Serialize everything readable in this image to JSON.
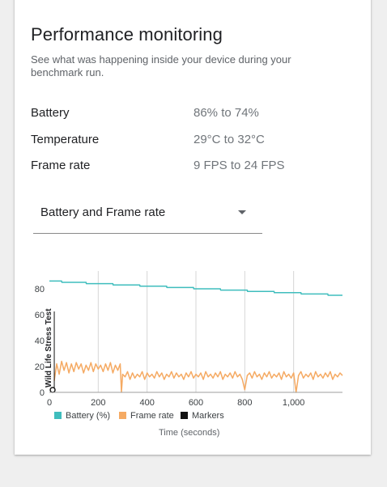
{
  "card": {
    "title": "Performance monitoring",
    "subtitle": "See what was happening inside your device during your benchmark run."
  },
  "metrics": [
    {
      "label": "Battery",
      "value": "86% to 74%"
    },
    {
      "label": "Temperature",
      "value": "29°C to 32°C"
    },
    {
      "label": "Frame rate",
      "value": "9 FPS to 24 FPS"
    }
  ],
  "dropdown": {
    "selected": "Battery and Frame rate",
    "icon": "arrow-drop-down-icon"
  },
  "colors": {
    "battery": "#3fbdbd",
    "frame_rate": "#f5aa63",
    "markers": "#111111",
    "grid": "#d6d6d6"
  },
  "chart_data": {
    "type": "line",
    "xlabel": "Time (seconds)",
    "ylabel": "",
    "xlim": [
      0,
      1200
    ],
    "ylim": [
      0,
      90
    ],
    "x_ticks": [
      0,
      200,
      400,
      600,
      800,
      1000
    ],
    "x_tick_labels": [
      "0",
      "200",
      "400",
      "600",
      "800",
      "1,000"
    ],
    "y_ticks": [
      0,
      20,
      40,
      60,
      80
    ],
    "y_tick_labels": [
      "0",
      "20",
      "40",
      "60",
      "80"
    ],
    "grid": "vertical",
    "legend_position": "bottom",
    "markers": [
      {
        "x": 20,
        "label": "Wild Life Stress Test"
      }
    ],
    "series": [
      {
        "name": "Battery (%)",
        "x": [
          0,
          50,
          51,
          150,
          151,
          260,
          261,
          370,
          371,
          480,
          481,
          590,
          591,
          700,
          701,
          810,
          811,
          920,
          921,
          1030,
          1031,
          1140,
          1141,
          1200
        ],
        "values": [
          86,
          86,
          85,
          85,
          84,
          84,
          83,
          83,
          82,
          82,
          81,
          81,
          80,
          80,
          79,
          79,
          78,
          78,
          77,
          77,
          76,
          76,
          75,
          75
        ]
      },
      {
        "name": "Frame rate",
        "x": [
          20,
          30,
          40,
          50,
          60,
          70,
          80,
          90,
          100,
          110,
          120,
          130,
          140,
          150,
          160,
          170,
          180,
          190,
          200,
          210,
          220,
          230,
          240,
          250,
          260,
          270,
          280,
          290,
          295,
          300,
          310,
          320,
          330,
          340,
          350,
          360,
          370,
          380,
          390,
          400,
          410,
          420,
          430,
          440,
          450,
          460,
          470,
          480,
          490,
          500,
          510,
          520,
          530,
          540,
          550,
          560,
          570,
          580,
          590,
          600,
          610,
          620,
          630,
          640,
          650,
          660,
          670,
          680,
          690,
          700,
          710,
          720,
          730,
          740,
          750,
          760,
          770,
          780,
          790,
          800,
          810,
          820,
          830,
          840,
          850,
          860,
          870,
          880,
          890,
          900,
          910,
          920,
          930,
          940,
          950,
          960,
          970,
          980,
          990,
          1000,
          1010,
          1020,
          1030,
          1040,
          1050,
          1060,
          1070,
          1080,
          1090,
          1100,
          1110,
          1120,
          1130,
          1140,
          1150,
          1160,
          1170,
          1180,
          1190,
          1200
        ],
        "values": [
          9,
          22,
          14,
          24,
          17,
          23,
          15,
          22,
          16,
          23,
          18,
          22,
          15,
          21,
          17,
          23,
          16,
          22,
          18,
          21,
          16,
          22,
          17,
          23,
          15,
          21,
          17,
          22,
          0,
          14,
          12,
          16,
          10,
          15,
          11,
          14,
          12,
          16,
          10,
          15,
          12,
          14,
          11,
          16,
          12,
          15,
          10,
          14,
          12,
          16,
          11,
          15,
          12,
          14,
          10,
          15,
          12,
          16,
          11,
          14,
          12,
          15,
          10,
          16,
          12,
          14,
          11,
          15,
          12,
          16,
          10,
          14,
          12,
          15,
          11,
          16,
          12,
          14,
          10,
          2,
          13,
          15,
          11,
          16,
          12,
          14,
          10,
          15,
          12,
          16,
          11,
          14,
          12,
          15,
          10,
          16,
          12,
          14,
          11,
          15,
          0,
          13,
          16,
          11,
          14,
          12,
          15,
          10,
          16,
          12,
          14,
          11,
          15,
          12,
          16,
          10,
          14,
          12,
          15,
          13
        ]
      }
    ]
  },
  "legend": [
    {
      "label": "Battery (%)",
      "color": "#3fbdbd"
    },
    {
      "label": "Frame rate",
      "color": "#f5aa63"
    },
    {
      "label": "Markers",
      "color": "#111111"
    }
  ]
}
